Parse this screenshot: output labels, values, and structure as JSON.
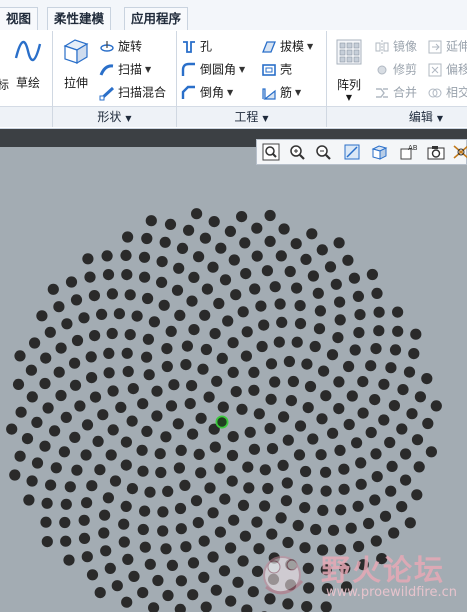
{
  "tabs": [
    {
      "label": "视图"
    },
    {
      "label": "柔性建模"
    },
    {
      "label": "应用程序"
    }
  ],
  "ribbon": {
    "partial_left_label": "标",
    "sketch_label": "草绘",
    "extrude_label": "拉伸",
    "revolve_label": "旋转",
    "sweep_label": "扫描",
    "swept_blend_label": "扫描混合",
    "hole_label": "孔",
    "round_label": "倒圆角",
    "chamfer_label": "倒角",
    "draft_label": "拔模",
    "shell_label": "壳",
    "rib_label": "筋",
    "pattern_label": "阵列",
    "mirror_label": "镜像",
    "trim_label": "修剪",
    "merge_label": "合并",
    "extend_label": "延伸",
    "offset_label": "偏移",
    "intersect_label": "相交",
    "groups": {
      "shape": "形状",
      "engineering": "工程",
      "editing": "编辑"
    }
  },
  "watermark": {
    "brand_text": "野火论坛",
    "url_text": "www.proewildfire.cn"
  },
  "colors": {
    "viewport_bg": "#a3acb3",
    "dot": "#2a2a2a",
    "selected_dot": "#1f3d1f",
    "selected_outline": "#3cc93c",
    "accent": "#2a6fc9"
  },
  "icons": [
    "sketch-icon",
    "extrude-icon",
    "revolve-icon",
    "sweep-icon",
    "swept-blend-icon",
    "hole-icon",
    "round-icon",
    "chamfer-icon",
    "draft-icon",
    "shell-icon",
    "rib-icon",
    "pattern-icon",
    "mirror-icon",
    "trim-icon",
    "merge-icon",
    "extend-icon",
    "offset-icon",
    "intersect-icon",
    "zoom-fit-icon",
    "zoom-in-icon",
    "zoom-out-icon",
    "repaint-icon",
    "saved-views-icon",
    "display-style-icon",
    "camera-icon",
    "datum-icon"
  ]
}
